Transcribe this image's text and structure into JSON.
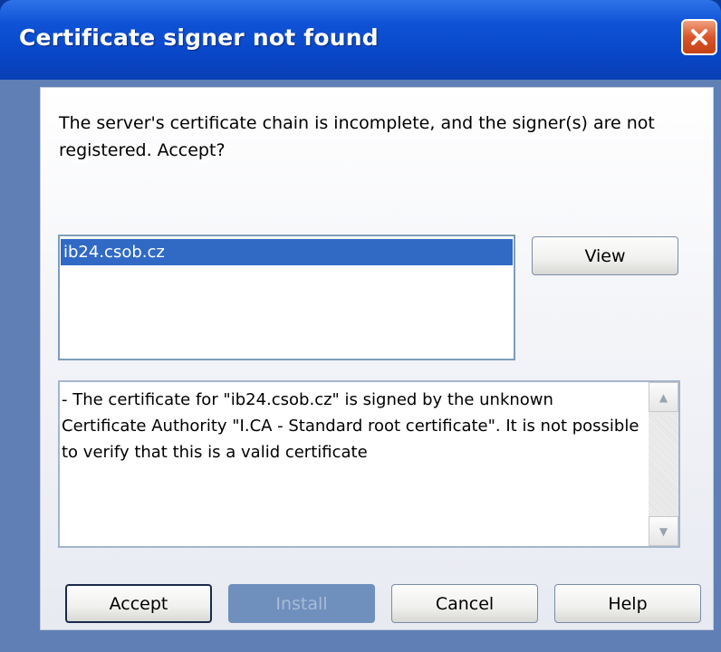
{
  "dialog": {
    "title": "Certificate signer not found",
    "message": "The server's certificate chain is incomplete, and the signer(s) are not registered. Accept?",
    "certificate_list": [
      "ib24.csob.cz"
    ],
    "details_text": "- The certificate for \"ib24.csob.cz\" is signed by the unknown Certificate Authority \"I.CA - Standard root certificate\". It is not possible to verify that this is a valid certificate",
    "buttons": {
      "view": "View",
      "accept": "Accept",
      "install": "Install",
      "cancel": "Cancel",
      "help": "Help"
    },
    "icons": {
      "close": "close-icon",
      "scroll_up": "scroll-up-arrow-icon",
      "scroll_down": "scroll-down-arrow-icon"
    },
    "colors": {
      "titlebar": "#0f52d6",
      "selection": "#316ac5",
      "close_button": "#d9552a",
      "disabled_button": "#6f8fbd"
    }
  }
}
